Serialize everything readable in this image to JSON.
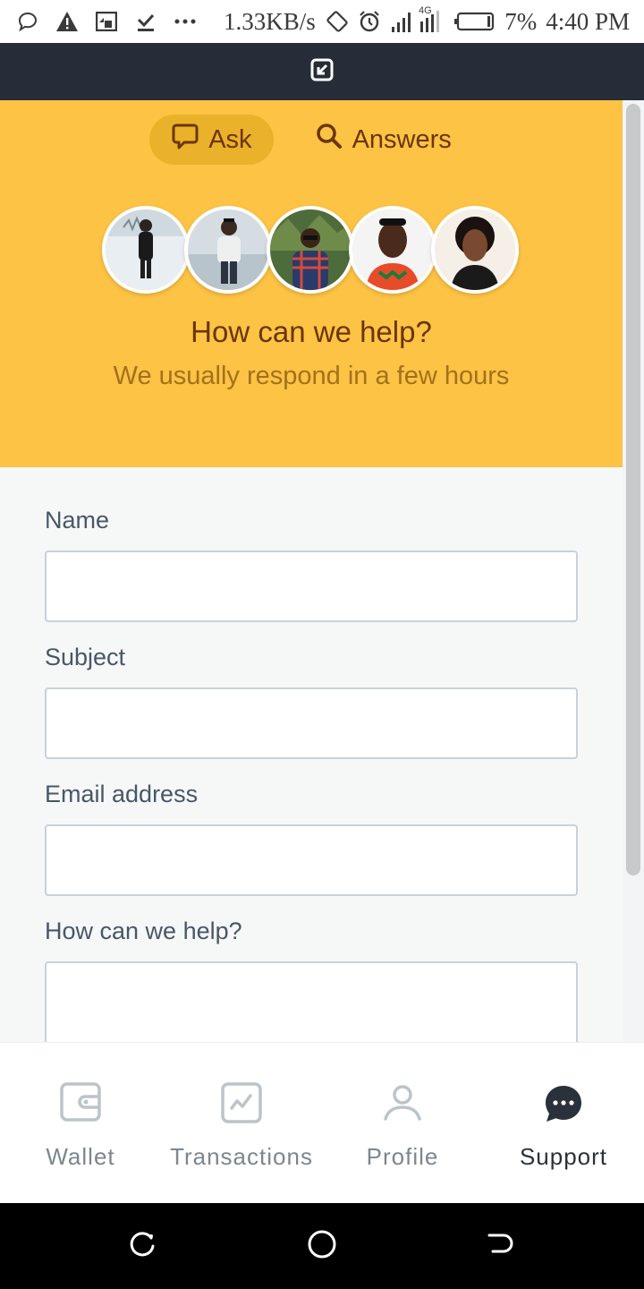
{
  "status_bar": {
    "network_speed": "1.33KB/s",
    "network_type": "4G",
    "battery": "7%",
    "time": "4:40 PM",
    "icons": [
      "chat-bubble-icon",
      "warning-icon",
      "screen-cast-icon",
      "download-done-icon",
      "more-icon",
      "rotate-icon",
      "alarm-icon",
      "signal-icon",
      "battery-icon"
    ]
  },
  "toolbar": {
    "icon": "minimize-icon"
  },
  "header": {
    "tabs": [
      {
        "label": "Ask",
        "icon": "chat-icon",
        "active": true
      },
      {
        "label": "Answers",
        "icon": "search-icon",
        "active": false
      }
    ],
    "title": "How can we help?",
    "subtitle": "We usually respond in a few hours",
    "avatar_count": 5
  },
  "form": {
    "fields": [
      {
        "label": "Name",
        "value": ""
      },
      {
        "label": "Subject",
        "value": ""
      },
      {
        "label": "Email address",
        "value": ""
      },
      {
        "label": "How can we help?",
        "value": ""
      }
    ]
  },
  "bottom_nav": {
    "items": [
      {
        "label": "Wallet",
        "icon": "wallet-icon",
        "active": false
      },
      {
        "label": "Transactions",
        "icon": "transactions-icon",
        "active": false
      },
      {
        "label": "Profile",
        "icon": "profile-icon",
        "active": false
      },
      {
        "label": "Support",
        "icon": "support-chat-icon",
        "active": true
      }
    ]
  },
  "colors": {
    "header_bg": "#fcc344",
    "active_tab_bg": "#eab12a",
    "header_text": "#6b3508",
    "subtitle_text": "#a3701d",
    "toolbar_bg": "#262d38",
    "form_bg": "#f6f8f8"
  }
}
